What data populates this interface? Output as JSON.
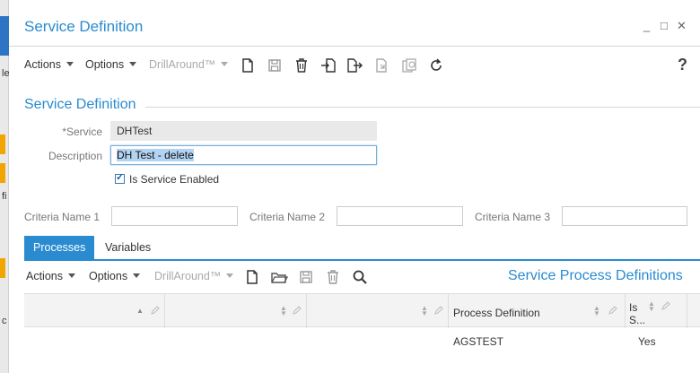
{
  "window": {
    "title": "Service Definition",
    "minimize_glyph": "_",
    "maximize_glyph": "□",
    "close_glyph": "✕"
  },
  "toolbar": {
    "actions_label": "Actions",
    "options_label": "Options",
    "drillaround_label": "DrillAround™",
    "icons": [
      "new-document-icon",
      "save-icon",
      "delete-icon",
      "import-icon",
      "export-icon",
      "copy-icon",
      "clone-icon",
      "refresh-icon"
    ],
    "help_label": "?"
  },
  "section": {
    "title": "Service Definition"
  },
  "form": {
    "service_label": "*Service",
    "service_value": "DHTest",
    "description_label": "Description",
    "description_value": "DH Test - delete",
    "enabled_label": "Is Service Enabled",
    "enabled_checked": true,
    "criteria1_label": "Criteria Name 1",
    "criteria2_label": "Criteria Name 2",
    "criteria3_label": "Criteria Name 3"
  },
  "tabs": [
    {
      "label": "Processes",
      "active": true
    },
    {
      "label": "Variables",
      "active": false
    }
  ],
  "subpanel": {
    "actions_label": "Actions",
    "options_label": "Options",
    "drillaround_label": "DrillAround™",
    "title": "Service Process Definitions"
  },
  "grid": {
    "columns": [
      {
        "label": ""
      },
      {
        "label": ""
      },
      {
        "label": ""
      },
      {
        "label": "Process Definition"
      },
      {
        "label": "Is S..."
      }
    ],
    "rows": [
      {
        "process_definition": "AGSTEST",
        "is_service": "Yes"
      }
    ]
  },
  "colors": {
    "accent": "#2a8bd0",
    "readonly_bg": "#e9e9e9",
    "selection": "#b3d3f2"
  }
}
